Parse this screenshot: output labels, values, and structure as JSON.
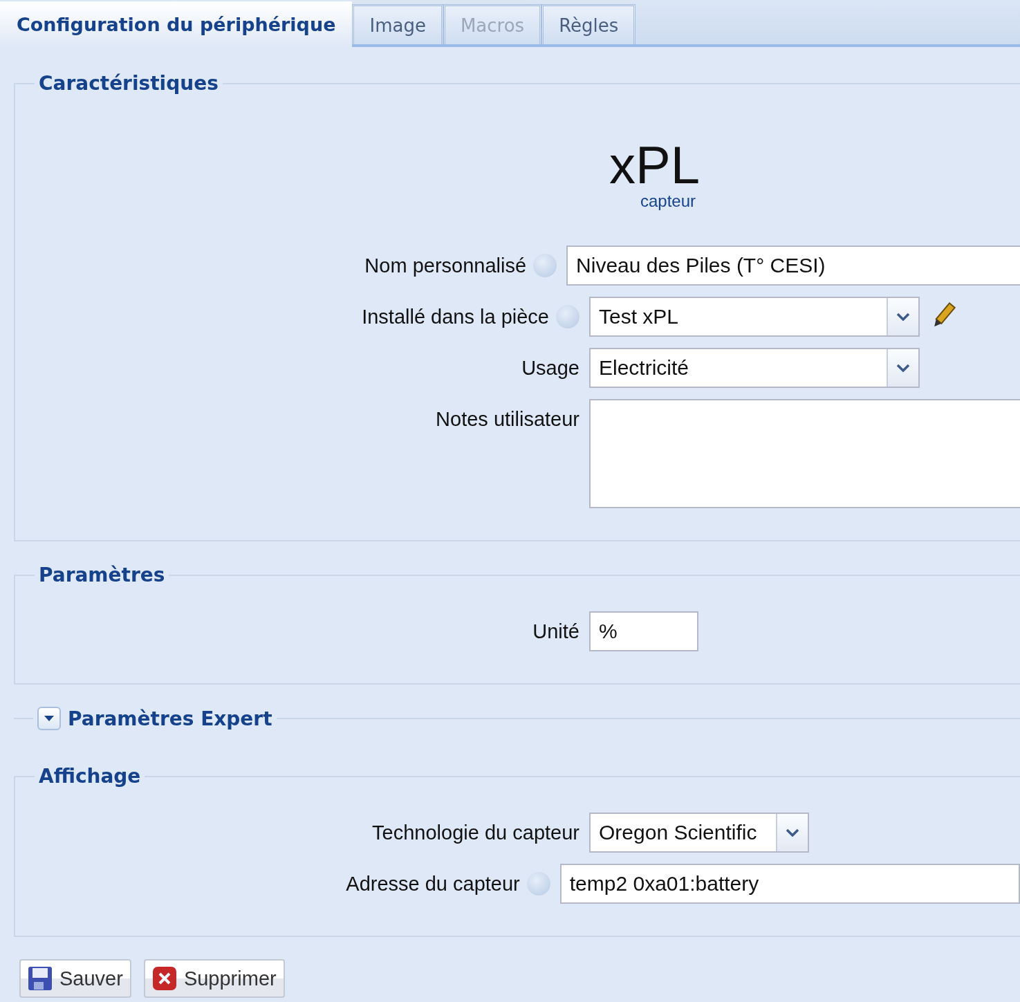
{
  "tabs": [
    {
      "label": "Configuration du périphérique",
      "selected": true,
      "disabled": false
    },
    {
      "label": "Image",
      "selected": false,
      "disabled": false
    },
    {
      "label": "Macros",
      "selected": false,
      "disabled": true
    },
    {
      "label": "Règles",
      "selected": false,
      "disabled": false
    }
  ],
  "sections": [
    {
      "kind": "fieldset",
      "legend": "Caractéristiques",
      "header": {
        "title": "xPL",
        "subtitle": "capteur"
      },
      "fields": [
        {
          "kind": "text",
          "label": "Nom personnalisé",
          "help": true,
          "value": "Niveau des Piles (T° CESI)"
        },
        {
          "kind": "select",
          "label": "Installé dans la pièce",
          "help": true,
          "value": "Test xPL",
          "edit": true
        },
        {
          "kind": "select",
          "label": "Usage",
          "help": false,
          "value": "Electricité"
        },
        {
          "kind": "textarea",
          "label": "Notes utilisateur",
          "help": false
        }
      ]
    },
    {
      "kind": "fieldset",
      "legend": "Paramètres",
      "fields": [
        {
          "kind": "short",
          "label": "Unité",
          "help": false,
          "value": "%"
        }
      ]
    },
    {
      "kind": "collapsed",
      "legend": "Paramètres Expert",
      "expanded": false
    },
    {
      "kind": "fieldset",
      "legend": "Affichage",
      "fields": [
        {
          "kind": "narrowselect",
          "label": "Technologie du capteur",
          "help": false,
          "value": "Oregon Scientific"
        },
        {
          "kind": "text",
          "label": "Adresse du capteur",
          "help": true,
          "value": "temp2 0xa01:battery"
        }
      ]
    }
  ],
  "buttons": [
    {
      "kind": "save",
      "label": "Sauver"
    },
    {
      "kind": "delete",
      "label": "Supprimer"
    }
  ]
}
